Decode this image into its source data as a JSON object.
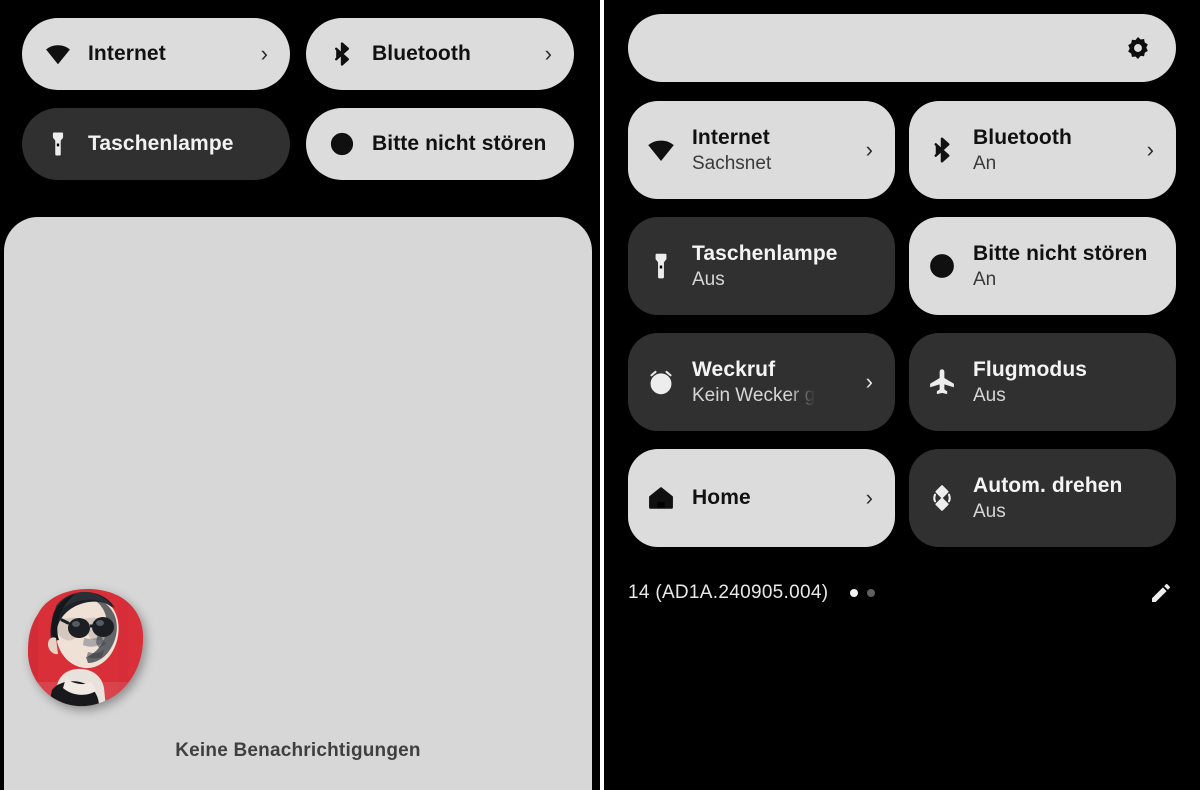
{
  "left_panel": {
    "name": "quick-settings-collapsed",
    "tiles": [
      {
        "icon": "wifi-icon",
        "label": "Internet",
        "state": "on",
        "chevron": "›"
      },
      {
        "icon": "bluetooth-icon",
        "label": "Bluetooth",
        "state": "on",
        "chevron": "›"
      },
      {
        "icon": "flashlight-icon",
        "label": "Taschenlampe",
        "state": "off",
        "chevron": ""
      },
      {
        "icon": "dnd-icon",
        "label": "Bitte nicht stören",
        "state": "on",
        "chevron": ""
      }
    ],
    "notification_shade": {
      "empty_text": "Keine Benachrichtigungen",
      "avatar": {
        "name": "user-avatar",
        "description": "Portrait illustration with sunglasses on red background",
        "background_color": "#E03038",
        "skin_color": "#F2E3DA",
        "hair_color": "#2C3136"
      }
    }
  },
  "right_panel": {
    "name": "quick-settings-expanded",
    "brightness": {
      "icon": "brightness-icon",
      "value_label": ""
    },
    "tiles": [
      {
        "icon": "wifi-icon",
        "title": "Internet",
        "subtitle": "Sachsnet",
        "state": "on",
        "chevron": "›",
        "clipped": false
      },
      {
        "icon": "bluetooth-icon",
        "title": "Bluetooth",
        "subtitle": "An",
        "state": "on",
        "chevron": "›",
        "clipped": false
      },
      {
        "icon": "flashlight-icon",
        "title": "Taschenlampe",
        "subtitle": "Aus",
        "state": "off",
        "chevron": "",
        "clipped": false
      },
      {
        "icon": "dnd-icon",
        "title": "Bitte nicht stören",
        "subtitle": "An",
        "state": "on",
        "chevron": "",
        "clipped": false
      },
      {
        "icon": "alarm-icon",
        "title": "Weckruf",
        "subtitle": "Kein Wecker g",
        "state": "off",
        "chevron": "›",
        "clipped": true
      },
      {
        "icon": "airplane-icon",
        "title": "Flugmodus",
        "subtitle": "Aus",
        "state": "off",
        "chevron": "",
        "clipped": false
      },
      {
        "icon": "home-icon",
        "title": "Home",
        "subtitle": "",
        "state": "on",
        "chevron": "›",
        "clipped": false
      },
      {
        "icon": "autorotate-icon",
        "title": "Autom. drehen",
        "subtitle": "Aus",
        "state": "off",
        "chevron": "",
        "clipped": false
      }
    ],
    "footer": {
      "build_text": "14 (AD1A.240905.004)",
      "page_dots": {
        "count": 2,
        "active_index": 0
      },
      "edit_icon": "pencil-icon"
    }
  },
  "colors": {
    "background": "#000000",
    "tile_on": "#DCDCDC",
    "tile_off": "#303030",
    "shade": "#D7D7D7",
    "text_on_light": "#111111",
    "text_on_dark": "#F4F4F4"
  }
}
